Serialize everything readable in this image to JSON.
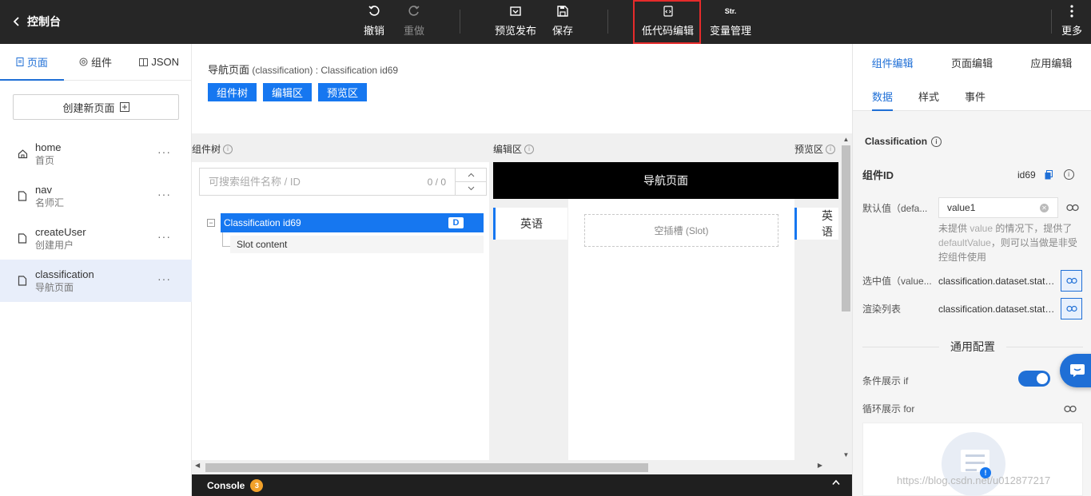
{
  "topbar": {
    "back_label": "控制台",
    "undo": "撤销",
    "redo": "重做",
    "preview_publish": "预览发布",
    "save": "保存",
    "lowcode_edit": "低代码编辑",
    "var_manage": "变量管理",
    "var_icon_text": "Str.",
    "more": "更多"
  },
  "sidebar": {
    "tabs": [
      {
        "label": "页面",
        "icon": "page-icon"
      },
      {
        "label": "组件",
        "icon": "component-icon"
      },
      {
        "label": "JSON",
        "icon": "json-icon"
      }
    ],
    "create_label": "创建新页面",
    "pages": [
      {
        "name": "home",
        "sub": "首页",
        "icon": "home-icon"
      },
      {
        "name": "nav",
        "sub": "名师汇",
        "icon": "file-icon"
      },
      {
        "name": "createUser",
        "sub": "创建用户",
        "icon": "file-icon"
      },
      {
        "name": "classification",
        "sub": "导航页面",
        "icon": "file-icon"
      }
    ],
    "more_glyph": "···"
  },
  "center": {
    "breadcrumb_main": "导航页面",
    "breadcrumb_rest": " (classification) : Classification id69",
    "view_buttons": [
      "组件树",
      "编辑区",
      "预览区"
    ],
    "pane_labels": {
      "tree": "组件树",
      "edit": "编辑区",
      "preview": "预览区"
    },
    "search_placeholder": "可搜索组件名称 / ID",
    "search_count": "0 / 0",
    "tree": {
      "node_label": "Classification id69",
      "node_badge": "D",
      "child_label": "Slot content"
    },
    "edit_nav_title": "导航页面",
    "edit_sidenav": "英语",
    "slot_label": "空插槽 (Slot)",
    "preview_sidenav": "英语"
  },
  "console": {
    "label": "Console",
    "count": "3"
  },
  "rpanel": {
    "tabs": [
      "组件编辑",
      "页面编辑",
      "应用编辑"
    ],
    "subtabs": [
      "数据",
      "样式",
      "事件"
    ],
    "section_title": "Classification",
    "component_id_label": "组件ID",
    "component_id_value": "id69",
    "default_label": "默认值（defa...",
    "default_value": "value1",
    "hint_pre": "未提供 ",
    "hint_code1": "value",
    "hint_mid": " 的情况下，提供了 ",
    "hint_code2": "defaultValue",
    "hint_post": "，则可以当做是非受控组件使用",
    "selected_label": "选中值（value...",
    "selected_value": "classification.dataset.state....",
    "render_label": "渲染列表",
    "render_value": "classification.dataset.state....",
    "general_title": "通用配置",
    "cond_label": "条件展示 if",
    "cond_on": true,
    "loop_label": "循环展示 for"
  },
  "watermark": "https://blog.csdn.net/u012877217",
  "colors": {
    "accent": "#1677f0",
    "highlight_border": "#e52b2b",
    "topbar": "#262626"
  }
}
